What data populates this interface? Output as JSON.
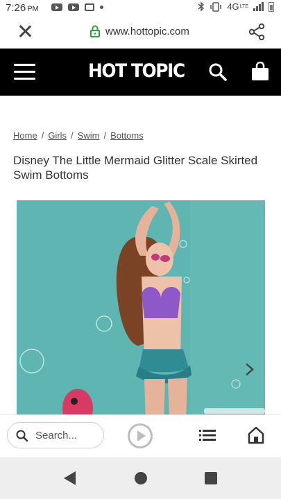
{
  "status_bar": {
    "time": "7:26",
    "ampm": "PM",
    "network": "4G",
    "lte": "LTE"
  },
  "browser": {
    "url": "www.hottopic.com",
    "search_placeholder": "Search..."
  },
  "site": {
    "logo": "HOT TOPIC"
  },
  "breadcrumb": [
    "Home",
    "Girls",
    "Swim",
    "Bottoms"
  ],
  "product": {
    "title": "Disney The Little Mermaid Glitter Scale Skirted Swim Bottoms"
  },
  "colors": {
    "header_bg": "#000000",
    "lock_green": "#2e9e44",
    "image_bg": "#5fb5b1"
  },
  "icons": [
    "close-icon",
    "lock-icon",
    "share-icon",
    "menu-icon",
    "search-icon",
    "shopping-bag-icon",
    "chevron-right-icon",
    "play-icon",
    "list-icon",
    "home-icon",
    "back-icon"
  ]
}
